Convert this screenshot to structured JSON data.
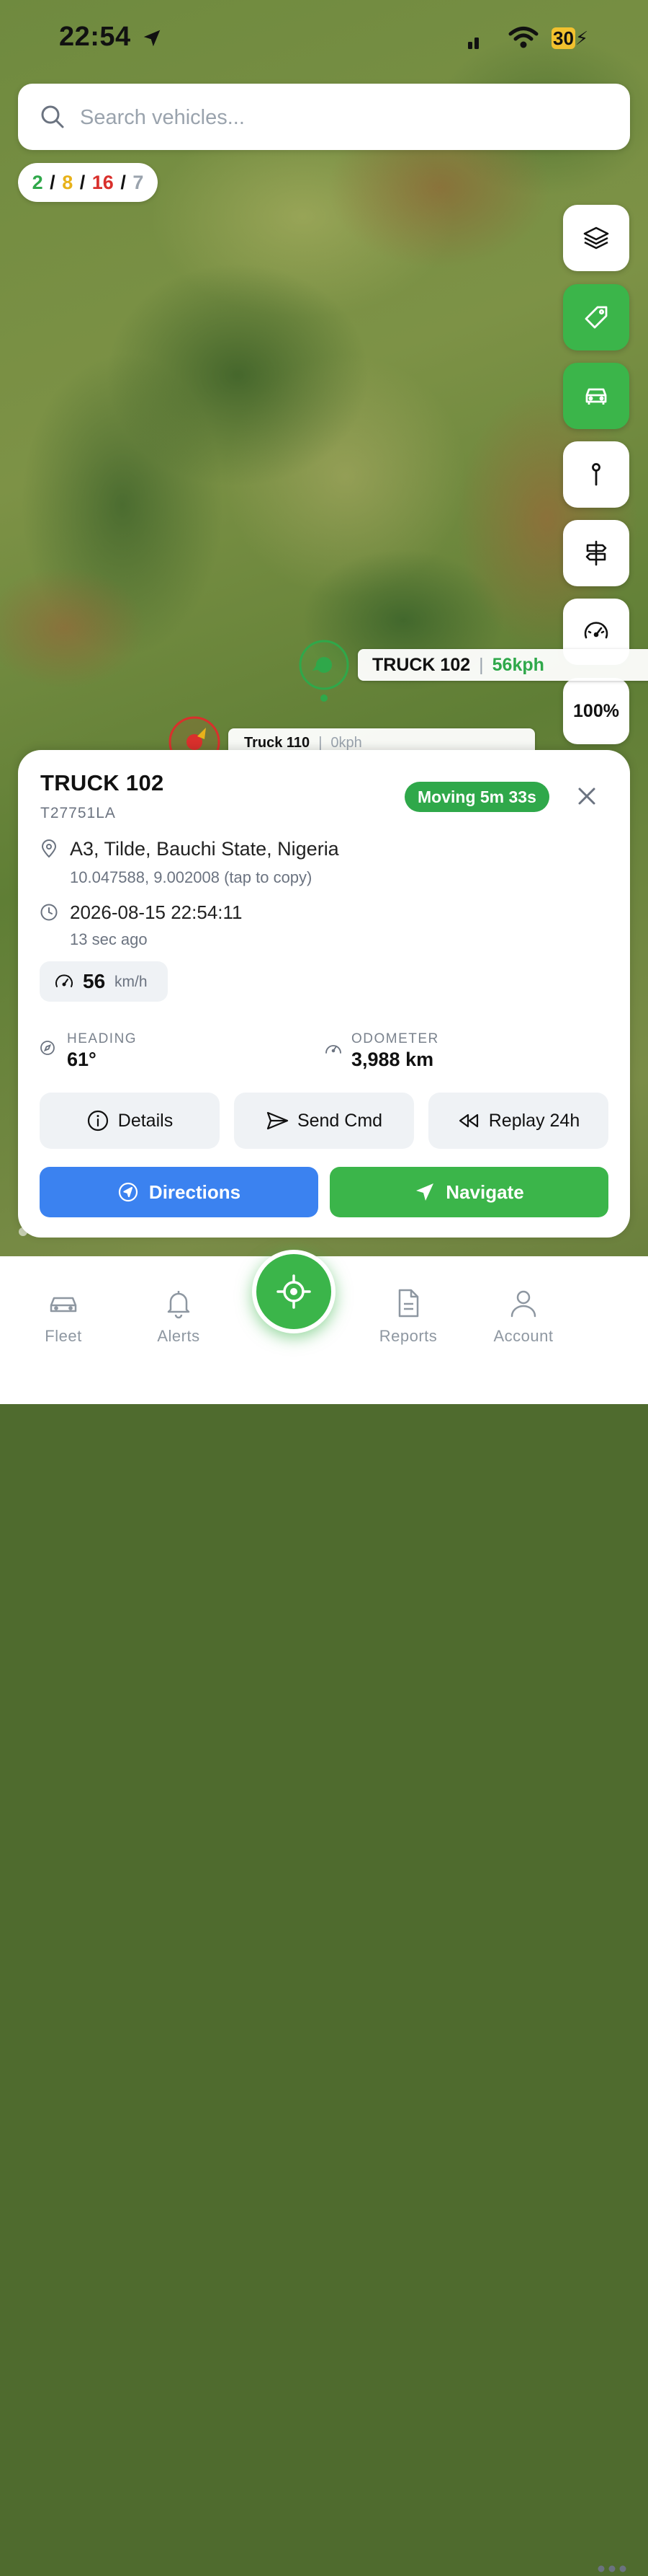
{
  "status_bar": {
    "time": "22:54",
    "battery": "30"
  },
  "search": {
    "placeholder": "Search vehicles..."
  },
  "fleet_counts": {
    "moving": "2",
    "idle": "8",
    "stopped": "16",
    "offline": "7",
    "separator": "/",
    "colors": {
      "moving": "#2fa84a",
      "idle": "#e8b21a",
      "stopped": "#d9302c",
      "offline": "#9aa3ad"
    }
  },
  "map_controls": {
    "layers_icon": "layers-icon",
    "labels_icon": "tag-icon",
    "vehicles_icon": "car-icon",
    "pin_icon": "pin-icon",
    "signpost_icon": "signpost-icon",
    "speedometer_icon": "speedometer-icon",
    "zoom": "100%"
  },
  "map_vehicles": [
    {
      "name": "TRUCK 102",
      "separator": "|",
      "speed": "56kph",
      "status": "moving"
    },
    {
      "name": "Truck 110",
      "separator": "|",
      "speed": "0kph",
      "status": "stopped"
    }
  ],
  "vehicle_card": {
    "title": "TRUCK 102",
    "plate": "T27751LA",
    "status_badge": "Moving 5m 33s",
    "address": "A3, Tilde, Bauchi State, Nigeria",
    "coordinates": "10.047588, 9.002008 (tap to copy)",
    "timestamp": "2026-08-15 22:54:11",
    "ago": "13 sec ago",
    "speed_value": "56",
    "speed_unit": "km/h",
    "heading_label": "HEADING",
    "heading_value": "61°",
    "odometer_label": "ODOMETER",
    "odometer_value": "3,988 km",
    "actions": {
      "details": "Details",
      "send_cmd": "Send Cmd",
      "replay": "Replay 24h",
      "directions": "Directions",
      "navigate": "Navigate"
    },
    "colors": {
      "accent_green": "#3bb54a",
      "accent_blue": "#3b82f0"
    }
  },
  "tab_bar": {
    "fleet": "Fleet",
    "alerts": "Alerts",
    "reports": "Reports",
    "account": "Account",
    "center_icon": "locate-icon",
    "more_icon": "more-icon"
  }
}
